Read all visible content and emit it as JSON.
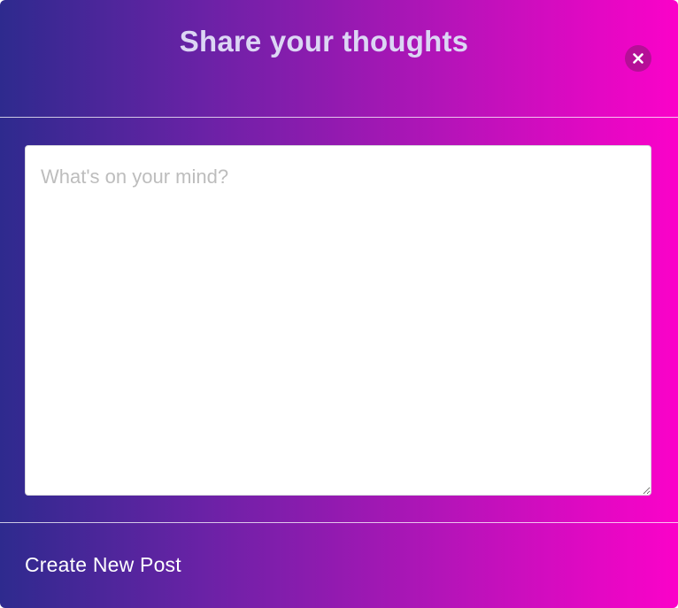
{
  "modal": {
    "title": "Share your thoughts",
    "close_icon": "close-icon",
    "textarea": {
      "placeholder": "What's on your mind?",
      "value": ""
    },
    "footer": {
      "create_label": "Create New Post"
    }
  },
  "colors": {
    "gradient_start": "#2e2a8e",
    "gradient_end": "#fb02c9",
    "close_button_bg": "#b50f97",
    "title_color": "#dcd6f4"
  }
}
